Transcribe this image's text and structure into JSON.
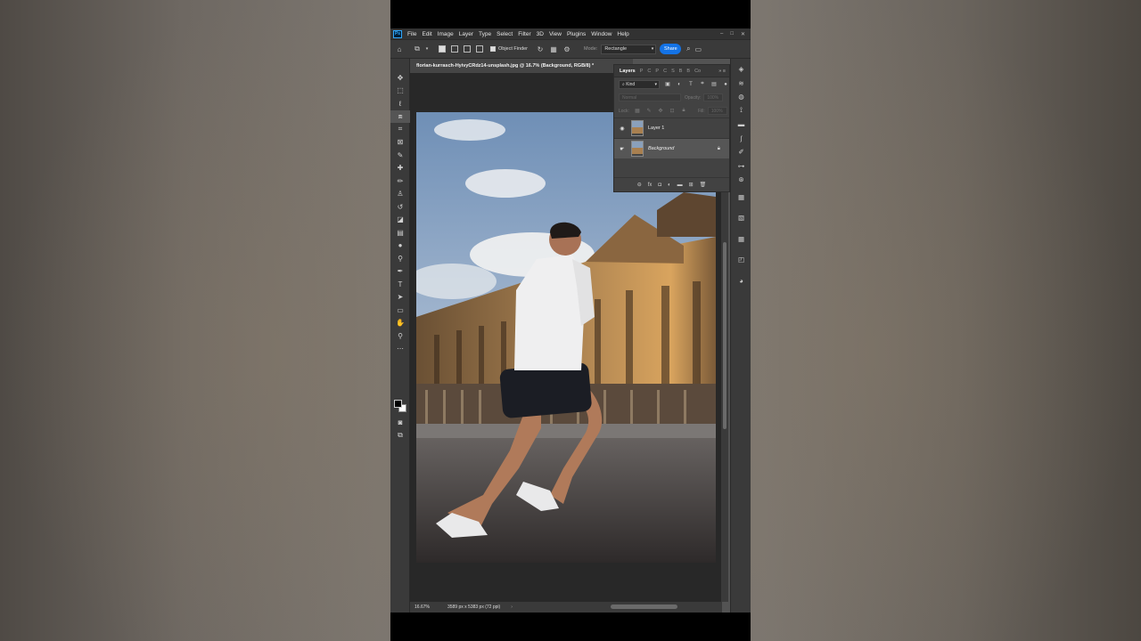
{
  "app": {
    "logo": "Ps",
    "menu": [
      "File",
      "Edit",
      "Image",
      "Layer",
      "Type",
      "Select",
      "Filter",
      "3D",
      "View",
      "Plugins",
      "Window",
      "Help"
    ],
    "window_controls": [
      "–",
      "□",
      "✕"
    ]
  },
  "options_bar": {
    "object_finder_label": "Object Finder",
    "mode_label": "Mode:",
    "mode_value": "Rectangle",
    "share_label": "Share"
  },
  "document": {
    "tab_title": "florian-kurrasch-HyivyCRdz14-unsplash.jpg @ 16.7% (Background, RGB/8) *"
  },
  "status": {
    "zoom": "16.67%",
    "dimensions": "3589 px x 5383 px (72 ppi)",
    "arrow": "›"
  },
  "layers_panel": {
    "tabs": [
      "Layers",
      "P",
      "C",
      "P",
      "C",
      "S",
      "B",
      "B",
      "Co"
    ],
    "filter_kind": "Kind",
    "blend_mode": "Normal",
    "opacity_label": "Opacity:",
    "opacity_value": "100%",
    "lock_label": "Lock:",
    "fill_label": "Fill:",
    "fill_value": "100%",
    "layers": [
      {
        "name": "Layer 1",
        "visible": true,
        "selected": false,
        "locked": false
      },
      {
        "name": "Background",
        "visible": true,
        "selected": true,
        "locked": true
      }
    ]
  },
  "tools": [
    "move-tool",
    "marquee-tool",
    "lasso-tool",
    "object-selection-tool",
    "crop-tool",
    "frame-tool",
    "eyedropper-tool",
    "healing-brush-tool",
    "brush-tool",
    "clone-stamp-tool",
    "history-brush-tool",
    "eraser-tool",
    "gradient-tool",
    "blur-tool",
    "dodge-tool",
    "pen-tool",
    "type-tool",
    "path-selection-tool",
    "rectangle-tool",
    "hand-tool",
    "zoom-tool",
    "more-tools"
  ],
  "colors": {
    "foreground": "#000000",
    "background": "#ffffff",
    "accent": "#1473e6"
  }
}
